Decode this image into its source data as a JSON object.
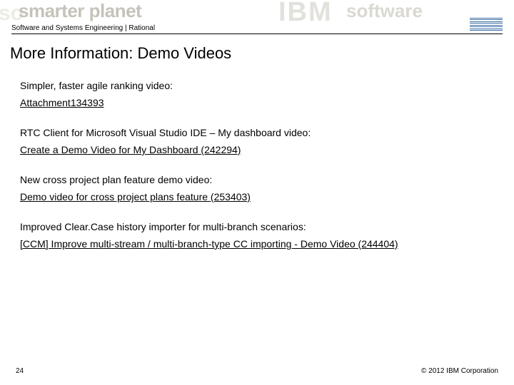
{
  "banner": {
    "slogan": "smarter planet",
    "ibm_ghost": "IBM",
    "software_ghost": "so",
    "software_ghost2": "software"
  },
  "header": {
    "breadcrumb": "Software and Systems Engineering | Rational"
  },
  "title": "More Information: Demo Videos",
  "sections": [
    {
      "label": "Simpler, faster agile ranking video:",
      "link": "Attachment134393"
    },
    {
      "label": "RTC Client for Microsoft Visual Studio IDE – My dashboard video:",
      "link": "Create a Demo Video for My Dashboard (242294)"
    },
    {
      "label": "New cross project plan feature demo video:",
      "link": "Demo video for cross project plans feature (253403)"
    },
    {
      "label": "Improved Clear.Case history importer for multi-branch scenarios:",
      "link": "[CCM] Improve multi-stream / multi-branch-type CC importing - Demo Video (244404)"
    }
  ],
  "footer": {
    "page_number": "24",
    "copyright": "© 2012 IBM Corporation"
  }
}
